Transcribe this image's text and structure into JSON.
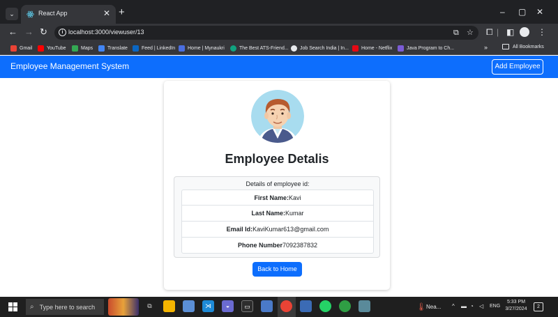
{
  "browser": {
    "tab_title": "React App",
    "tab_close": "✕",
    "new_tab": "+",
    "window_controls": {
      "minimize": "–",
      "maximize": "▢",
      "close": "✕"
    },
    "nav": {
      "back": "←",
      "forward": "→",
      "reload": "↻"
    },
    "url": "localhost:3000/viewuser/13",
    "bookmarks": [
      {
        "label": "Gmail",
        "color": "#ea4335"
      },
      {
        "label": "YouTube",
        "color": "#ff0000"
      },
      {
        "label": "Maps",
        "color": "#34a853"
      },
      {
        "label": "Translate",
        "color": "#4285f4"
      },
      {
        "label": "Feed | LinkedIn",
        "color": "#0a66c2"
      },
      {
        "label": "Home | Mynaukri",
        "color": "#4a6ee0"
      },
      {
        "label": "The Best ATS-Friend...",
        "color": "#10a37f"
      },
      {
        "label": "Job Search India | In...",
        "color": "#e8eaed"
      },
      {
        "label": "Home - Netflix",
        "color": "#e50914"
      },
      {
        "label": "Java Program to Ch...",
        "color": "#7b5cd6"
      }
    ],
    "bookmarks_more": "»",
    "all_bookmarks": "All Bookmarks"
  },
  "app": {
    "brand": "Employee Management System",
    "add_button": "Add Employee",
    "card_title": "Employee Detalis",
    "details_header": "Details of employee id:",
    "fields": [
      {
        "label": "First Name:",
        "value": "Kavi"
      },
      {
        "label": "Last Name:",
        "value": "Kumar"
      },
      {
        "label": "Email Id:",
        "value": "KaviKumar613@gmail.com"
      },
      {
        "label": "Phone Number",
        "value": "7092387832"
      }
    ],
    "back_button": "Back to Home"
  },
  "taskbar": {
    "search_placeholder": "Type here to search",
    "weather": "Nea...",
    "language": "ENG",
    "time": "5:33 PM",
    "date": "3/27/2024",
    "notification_count": "2"
  },
  "colors": {
    "primary": "#0d6efd",
    "browser_dark": "#202124",
    "browser_toolbar": "#35363a",
    "taskbar": "#1f1f1f"
  }
}
